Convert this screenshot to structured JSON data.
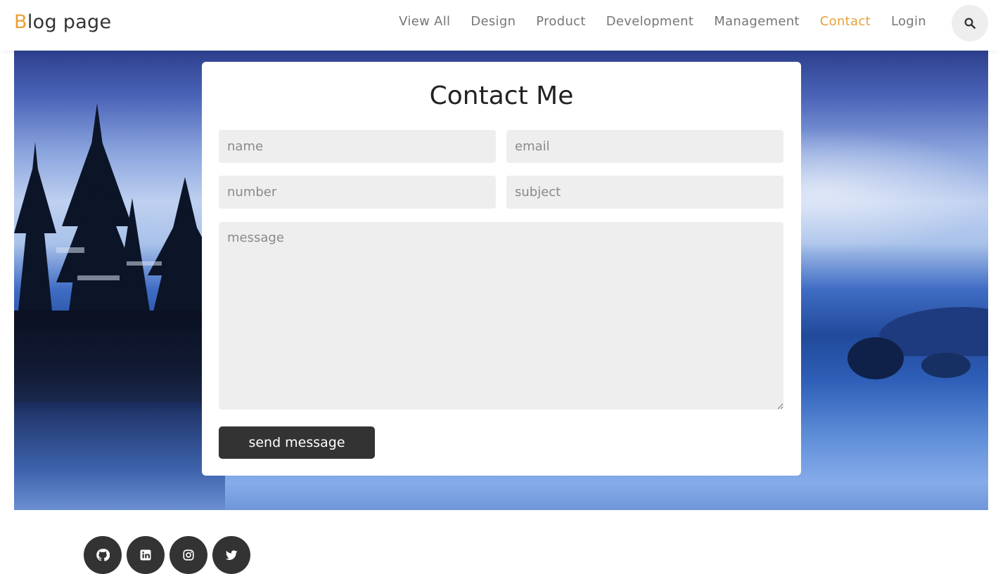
{
  "header": {
    "logo_first_letter": "B",
    "logo_rest": "log page",
    "nav": [
      {
        "label": "View All"
      },
      {
        "label": "Design"
      },
      {
        "label": "Product"
      },
      {
        "label": "Development"
      },
      {
        "label": "Management"
      },
      {
        "label": "Contact",
        "active": true
      },
      {
        "label": "Login"
      }
    ],
    "search_icon": "search-icon"
  },
  "contact_form": {
    "title": "Contact Me",
    "name_placeholder": "name",
    "email_placeholder": "email",
    "number_placeholder": "number",
    "subject_placeholder": "subject",
    "message_placeholder": "message",
    "submit_label": "send message"
  },
  "social": [
    {
      "icon": "github-icon"
    },
    {
      "icon": "linkedin-icon"
    },
    {
      "icon": "instagram-icon"
    },
    {
      "icon": "twitter-icon"
    }
  ],
  "colors": {
    "accent": "#e8a03a",
    "button_dark": "#333333",
    "field_bg": "#eeeeee"
  }
}
